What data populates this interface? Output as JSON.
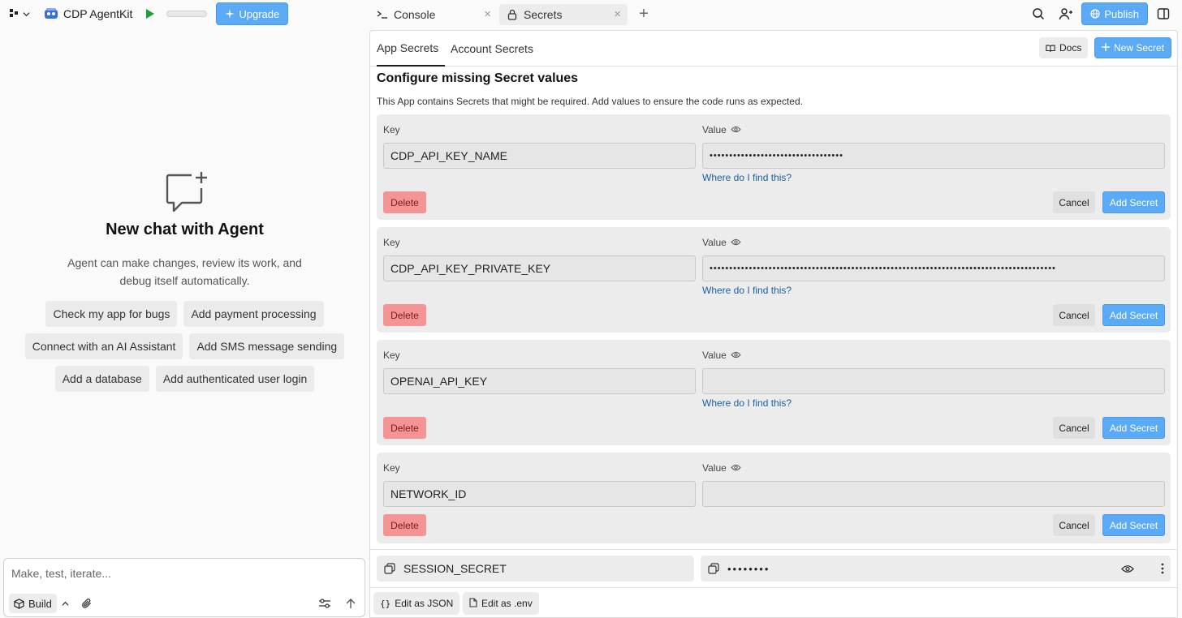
{
  "topbar": {
    "project_name": "CDP AgentKit",
    "upgrade_label": "Upgrade",
    "publish_label": "Publish",
    "icons": [
      "workspace-menu-icon",
      "chevron-down-icon",
      "project-logo-icon",
      "run-icon",
      "plus-icon",
      "search-icon",
      "invite-user-icon",
      "globe-icon",
      "sidebar-toggle-icon"
    ]
  },
  "tabs": {
    "console_label": "Console",
    "secrets_label": "Secrets"
  },
  "chat": {
    "title": "New chat with Agent",
    "description": "Agent can make changes, review its work, and debug itself automatically.",
    "suggestions_row1": [
      "Check my app for bugs",
      "Add payment processing"
    ],
    "suggestions_row2": [
      "Connect with an AI Assistant",
      "Add SMS message sending"
    ],
    "suggestions_row3": [
      "Add a database",
      "Add authenticated user login"
    ],
    "composer_placeholder": "Make, test, iterate...",
    "build_label": "Build"
  },
  "secrets": {
    "tab_app": "App Secrets",
    "tab_account": "Account Secrets",
    "docs_label": "Docs",
    "new_secret_label": "New Secret",
    "configure_title": "Configure missing Secret values",
    "configure_desc": "This App contains Secrets that might be required. Add values to ensure the code runs as expected.",
    "key_label": "Key",
    "value_label": "Value",
    "help_link": "Where do I find this?",
    "delete_label": "Delete",
    "cancel_label": "Cancel",
    "add_label": "Add Secret",
    "missing": [
      {
        "key": "CDP_API_KEY_NAME",
        "value": "••••••••••••••••••••••••••••••••••"
      },
      {
        "key": "CDP_API_KEY_PRIVATE_KEY",
        "value": "••••••••••••••••••••••••••••••••••••••••••••••••••••••••••••••••••••••••••••••••••••••••"
      },
      {
        "key": "OPENAI_API_KEY",
        "value": ""
      },
      {
        "key": "NETWORK_ID",
        "value": ""
      }
    ],
    "saved": [
      {
        "key": "SESSION_SECRET",
        "value": "••••••••"
      }
    ],
    "edit_json_label": "Edit as JSON",
    "edit_env_label": "Edit as .env"
  },
  "colors": {
    "accent": "#5aaaf5",
    "danger": "#f59494",
    "link": "#1a5fa8"
  }
}
